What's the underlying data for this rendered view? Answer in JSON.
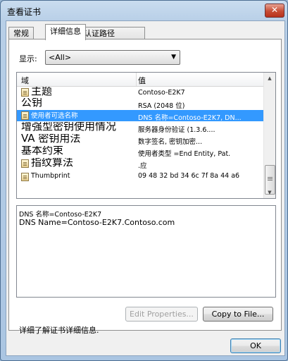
{
  "window": {
    "title": "查看证书",
    "close_glyph": "✕"
  },
  "tabs": [
    {
      "label": "常规"
    },
    {
      "label": "详细信息"
    },
    {
      "label": "认证路径"
    }
  ],
  "show": {
    "label": "显示:",
    "selected": "<All>"
  },
  "list": {
    "columns": [
      "域",
      "值"
    ],
    "rows": [
      {
        "field": "主题",
        "value": "Contoso-E2K7"
      },
      {
        "field": "公钥",
        "value": "RSA (2048 位)"
      },
      {
        "field": "使用者可选名称",
        "value": "DNS 名称=Contoso-E2K7, DN..."
      },
      {
        "field": "增强型密钥使用情况",
        "value": "服务器身份验证 (1.3.6...."
      },
      {
        "field": "VA 密钥用法",
        "value": "数字签名, 密钥加密..."
      },
      {
        "field": "基本约束",
        "value": "使用者类型 =End Entity, Pat."
      },
      {
        "field": "指纹算法",
        "value": ".应"
      },
      {
        "field": "Thumbprint",
        "value": "09 48 32 bd 34 6c 7f 8a 44 a6"
      }
    ]
  },
  "detail": {
    "lines": [
      "DNS 名称=Contoso-E2K7",
      "DNS Name=Contoso-E2K7.Contoso.com"
    ]
  },
  "buttons": {
    "edit_properties": "Edit Properties...",
    "copy_to_file": "Copy to File...",
    "ok": "OK"
  },
  "learn_more": "详细了解证书详细信息."
}
